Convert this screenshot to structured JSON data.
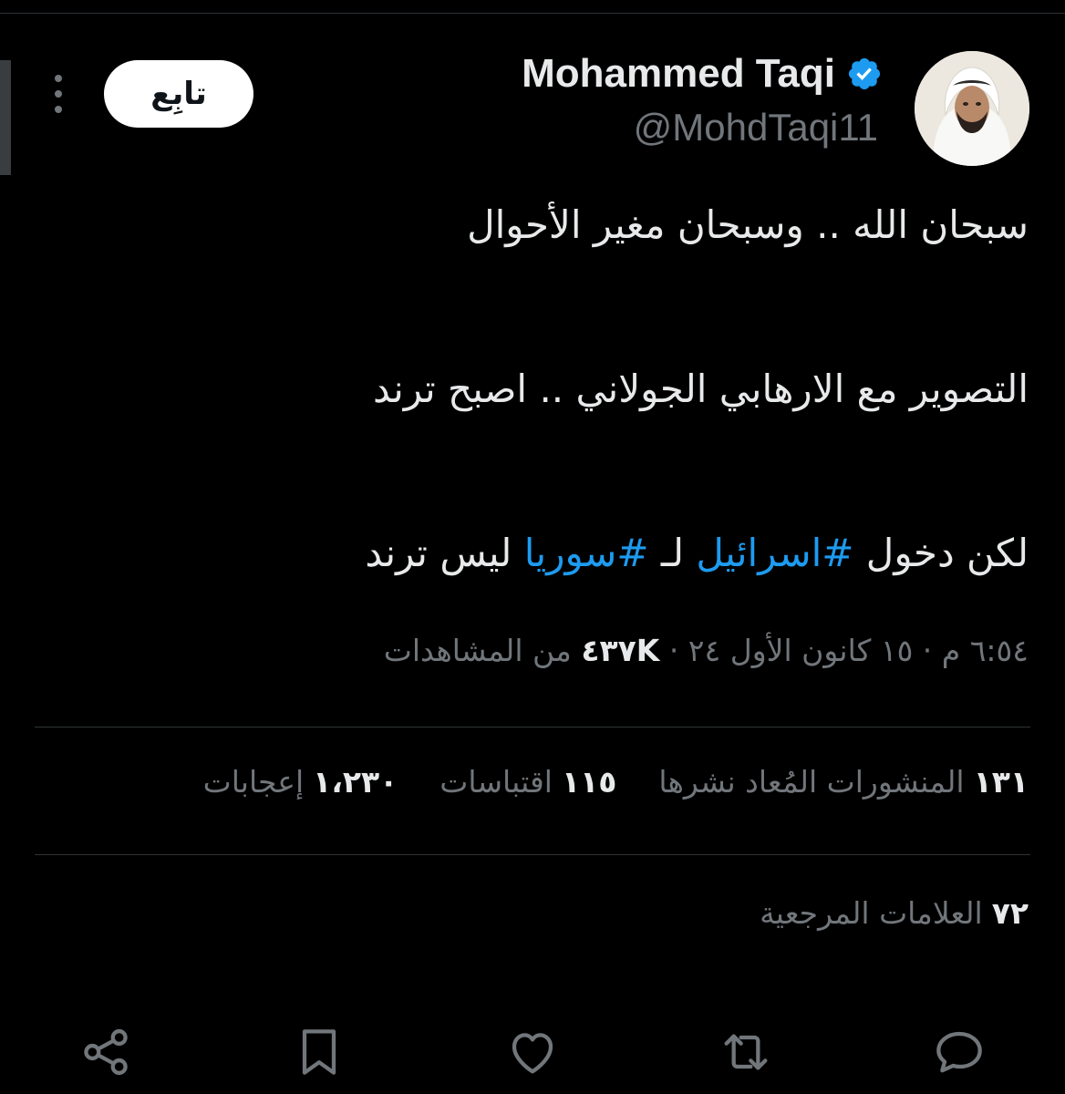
{
  "author": {
    "name": "Mohammed Taqi",
    "handle": "@MohdTaqi11",
    "verified": true
  },
  "follow_label": "تابِع",
  "tweet": {
    "line1": "سبحان الله .. وسبحان مغير الأحوال",
    "line2": "التصوير مع الارهابي الجولاني .. اصبح ترند",
    "line3_prefix": "لكن دخول ",
    "hashtag1": "#اسرائيل",
    "line3_mid": " لـ ",
    "hashtag2": "#سوريا",
    "line3_suffix": " ليس ترند"
  },
  "meta": {
    "timestamp": "٦:٥٤ م · ١٥ كانون الأول ٢٤ ·",
    "views_count": "٤٣٧K",
    "views_label": "من المشاهدات"
  },
  "stats": {
    "reposts_count": "١٣١",
    "reposts_label": "المنشورات المُعاد نشرها",
    "quotes_count": "١١٥",
    "quotes_label": "اقتباسات",
    "likes_count": "١،٢٣٠",
    "likes_label": "إعجابات",
    "bookmarks_count": "٧٢",
    "bookmarks_label": "العلامات المرجعية"
  },
  "icons": {
    "verified": "verified-badge-icon",
    "more": "more-vertical-icon",
    "reply": "reply-icon",
    "repost": "repost-icon",
    "like": "heart-icon",
    "bookmark": "bookmark-icon",
    "share": "share-icon"
  },
  "colors": {
    "background": "#000000",
    "text": "#e7e9ea",
    "secondary": "#71767b",
    "accent": "#1d9bf0",
    "divider": "#2f3336"
  }
}
